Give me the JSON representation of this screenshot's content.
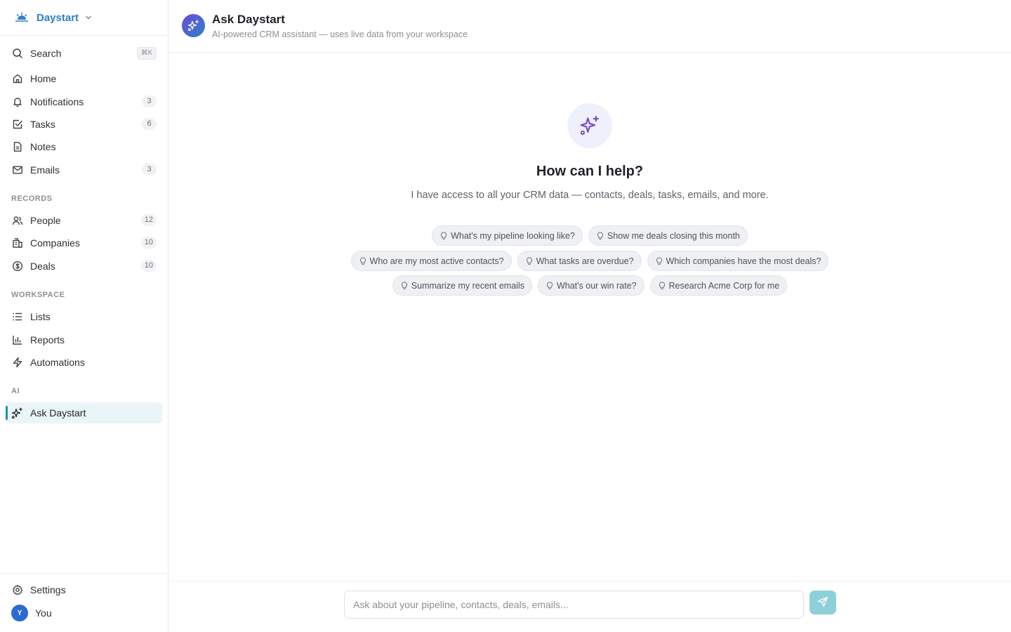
{
  "app": {
    "brand": "Daystart",
    "brand_color": "#2f7fc8",
    "accent_color": "#1597a8"
  },
  "sidebar": {
    "search": {
      "label": "Search",
      "shortcut": "⌘K"
    },
    "main_items": [
      {
        "label": "Home",
        "icon": "home-icon"
      },
      {
        "label": "Notifications",
        "icon": "bell-icon",
        "count": "3"
      },
      {
        "label": "Tasks",
        "icon": "check-square-icon",
        "count": "6"
      },
      {
        "label": "Notes",
        "icon": "file-text-icon"
      },
      {
        "label": "Emails",
        "icon": "mail-icon",
        "count": "3"
      }
    ],
    "records_label": "RECORDS",
    "records": [
      {
        "label": "People",
        "icon": "users-icon",
        "count": "12"
      },
      {
        "label": "Companies",
        "icon": "building-icon",
        "count": "10"
      },
      {
        "label": "Deals",
        "icon": "dollar-circle-icon",
        "count": "10"
      }
    ],
    "workspace_label": "WORKSPACE",
    "workspace": [
      {
        "label": "Lists",
        "icon": "list-icon"
      },
      {
        "label": "Reports",
        "icon": "bar-chart-icon"
      },
      {
        "label": "Automations",
        "icon": "zap-icon"
      }
    ],
    "ai_label": "AI",
    "ai": [
      {
        "label": "Ask Daystart",
        "icon": "sparkles-icon",
        "active": true
      }
    ],
    "settings_label": "Settings",
    "user": {
      "initial": "Y",
      "label": "You"
    }
  },
  "header": {
    "title": "Ask Daystart",
    "subtitle": "AI-powered CRM assistant — uses live data from your workspace"
  },
  "hero": {
    "title": "How can I help?",
    "subtitle": "I have access to all your CRM data — contacts, deals, tasks, emails, and more."
  },
  "suggestions": {
    "row1": [
      "What's my pipeline looking like?",
      "Show me deals closing this month"
    ],
    "row2": [
      "Who are my most active contacts?",
      "What tasks are overdue?",
      "Which companies have the most deals?"
    ],
    "row3": [
      "Summarize my recent emails",
      "What's our win rate?",
      "Research Acme Corp for me"
    ]
  },
  "composer": {
    "placeholder": "Ask about your pipeline, contacts, deals, emails...",
    "value": ""
  }
}
